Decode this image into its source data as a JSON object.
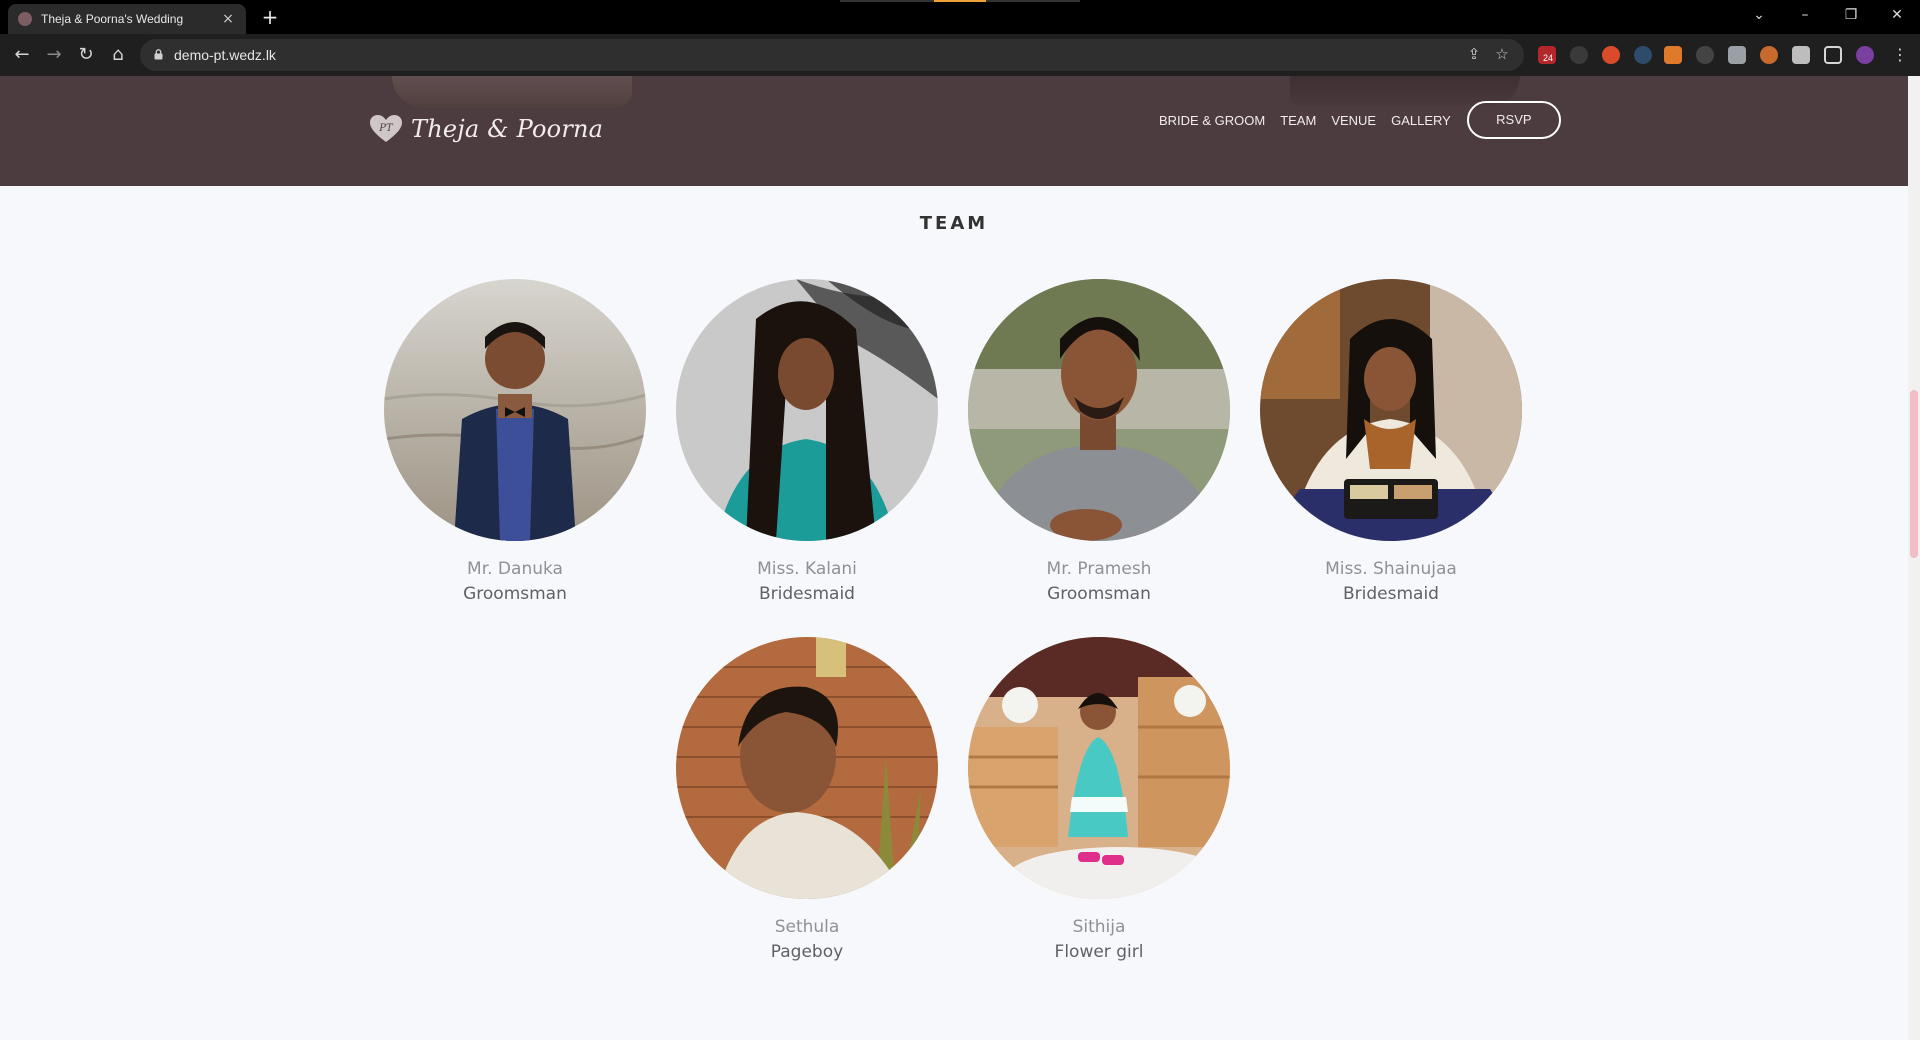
{
  "browser": {
    "tab_title": "Theja & Poorna's Wedding",
    "tab_close": "×",
    "new_tab": "+",
    "url": "demo-pt.wedz.lk",
    "window_controls": {
      "chevron": "⌄",
      "minimize": "–",
      "restore": "❐",
      "close": "✕"
    },
    "nav": {
      "back": "←",
      "forward": "→",
      "reload": "↻",
      "home": "⌂"
    },
    "omnibox_icons": {
      "share": "⇪",
      "bookmark": "☆"
    },
    "extension_badge": "24"
  },
  "site": {
    "logo_text": "Theja & Poorna",
    "nav": [
      "BRIDE & GROOM",
      "TEAM",
      "VENUE",
      "GALLERY"
    ],
    "rsvp_label": "RSVP",
    "accent": "#4d3c3f"
  },
  "team": {
    "title": "TEAM",
    "members": [
      {
        "name": "Mr. Danuka",
        "role": "Groomsman",
        "photo": "man-in-navy-suit-by-sea"
      },
      {
        "name": "Miss. Kalani",
        "role": "Bridesmaid",
        "photo": "woman-in-teal-top-long-hair"
      },
      {
        "name": "Mr. Pramesh",
        "role": "Groomsman",
        "photo": "smiling-man-grey-shirt"
      },
      {
        "name": "Miss. Shainujaa",
        "role": "Bridesmaid",
        "photo": "woman-at-restaurant-table"
      },
      {
        "name": "Sethula",
        "role": "Pageboy",
        "photo": "boy-by-brick-wall"
      },
      {
        "name": "Sithija",
        "role": "Flower girl",
        "photo": "girl-in-teal-dress-on-crate"
      }
    ]
  }
}
